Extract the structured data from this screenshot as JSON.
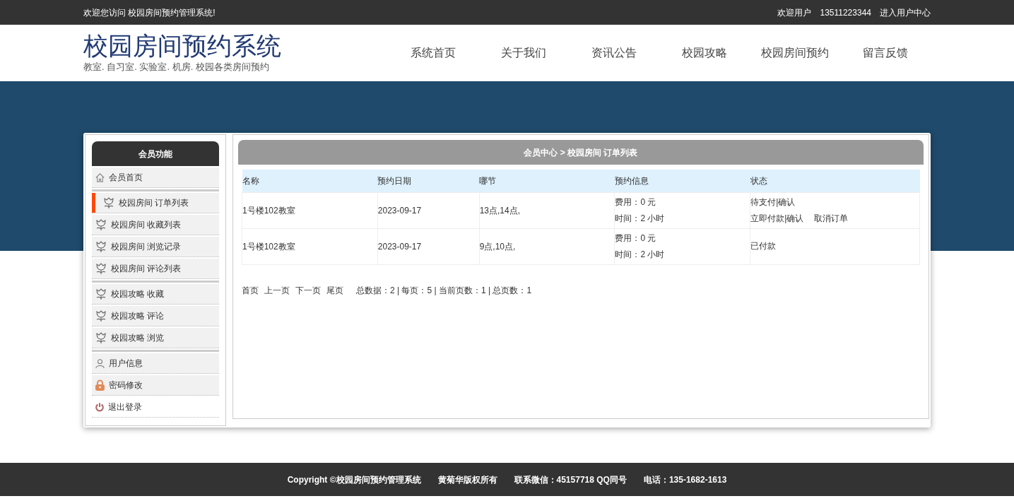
{
  "topbar": {
    "welcome": "欢迎您访问 校园房间预约管理系统!",
    "user_label": "欢迎用户",
    "user": "13511223344",
    "center_link": "进入用户中心"
  },
  "header": {
    "title": "校园房间预约系统",
    "subtitle": "教室. 自习室. 实验室. 机房. 校园各类房间预约",
    "nav": [
      {
        "label": "系统首页"
      },
      {
        "label": "关于我们"
      },
      {
        "label": "资讯公告"
      },
      {
        "label": "校园攻略"
      },
      {
        "label": "校园房间预约"
      },
      {
        "label": "留言反馈"
      }
    ]
  },
  "sidebar": {
    "title": "会员功能",
    "groups": [
      [
        {
          "kind": "home",
          "label": "会员首页",
          "selected": false
        }
      ],
      [
        {
          "kind": "flower",
          "label": "校园房间 订单列表",
          "selected": true
        },
        {
          "kind": "flower",
          "label": "校园房间 收藏列表",
          "selected": false
        },
        {
          "kind": "flower",
          "label": "校园房间 浏览记录",
          "selected": false
        },
        {
          "kind": "flower",
          "label": "校园房间 评论列表",
          "selected": false
        }
      ],
      [
        {
          "kind": "flower",
          "label": "校园攻略 收藏",
          "selected": false
        },
        {
          "kind": "flower",
          "label": "校园攻略 评论",
          "selected": false
        },
        {
          "kind": "flower",
          "label": "校园攻略 浏览",
          "selected": false
        }
      ],
      [
        {
          "kind": "user",
          "label": "用户信息",
          "selected": false
        },
        {
          "kind": "lock",
          "label": "密码修改",
          "selected": false
        },
        {
          "kind": "power",
          "label": "退出登录",
          "selected": false
        }
      ]
    ]
  },
  "main": {
    "breadcrumb": "会员中心 > 校园房间 订单列表",
    "table": {
      "columns": [
        "名称",
        "预约日期",
        "哪节",
        "预约信息",
        "状态"
      ],
      "rows": [
        {
          "name": "1号楼102教室",
          "date": "2023-09-17",
          "slots": "13点,14点,",
          "info": [
            "费用：0 元",
            "时间：2 小时"
          ],
          "status": "待支付|确认",
          "actions": [
            "立即付款|确认",
            "取消订单"
          ]
        },
        {
          "name": "1号楼102教室",
          "date": "2023-09-17",
          "slots": "9点,10点,",
          "info": [
            "费用：0 元",
            "时间：2 小时"
          ],
          "status": "已付款",
          "actions": []
        }
      ]
    },
    "pagination": {
      "links": [
        "首页",
        "上一页",
        "下一页",
        "尾页"
      ],
      "summary": "总数据：2 | 每页：5 | 当前页数：1 | 总页数：1"
    }
  },
  "footer": {
    "items": [
      "Copyright ©校园房间预约管理系统",
      "黄菊华版权所有",
      "联系微信：45157718 QQ同号",
      "电话：135-1682-1613"
    ]
  }
}
